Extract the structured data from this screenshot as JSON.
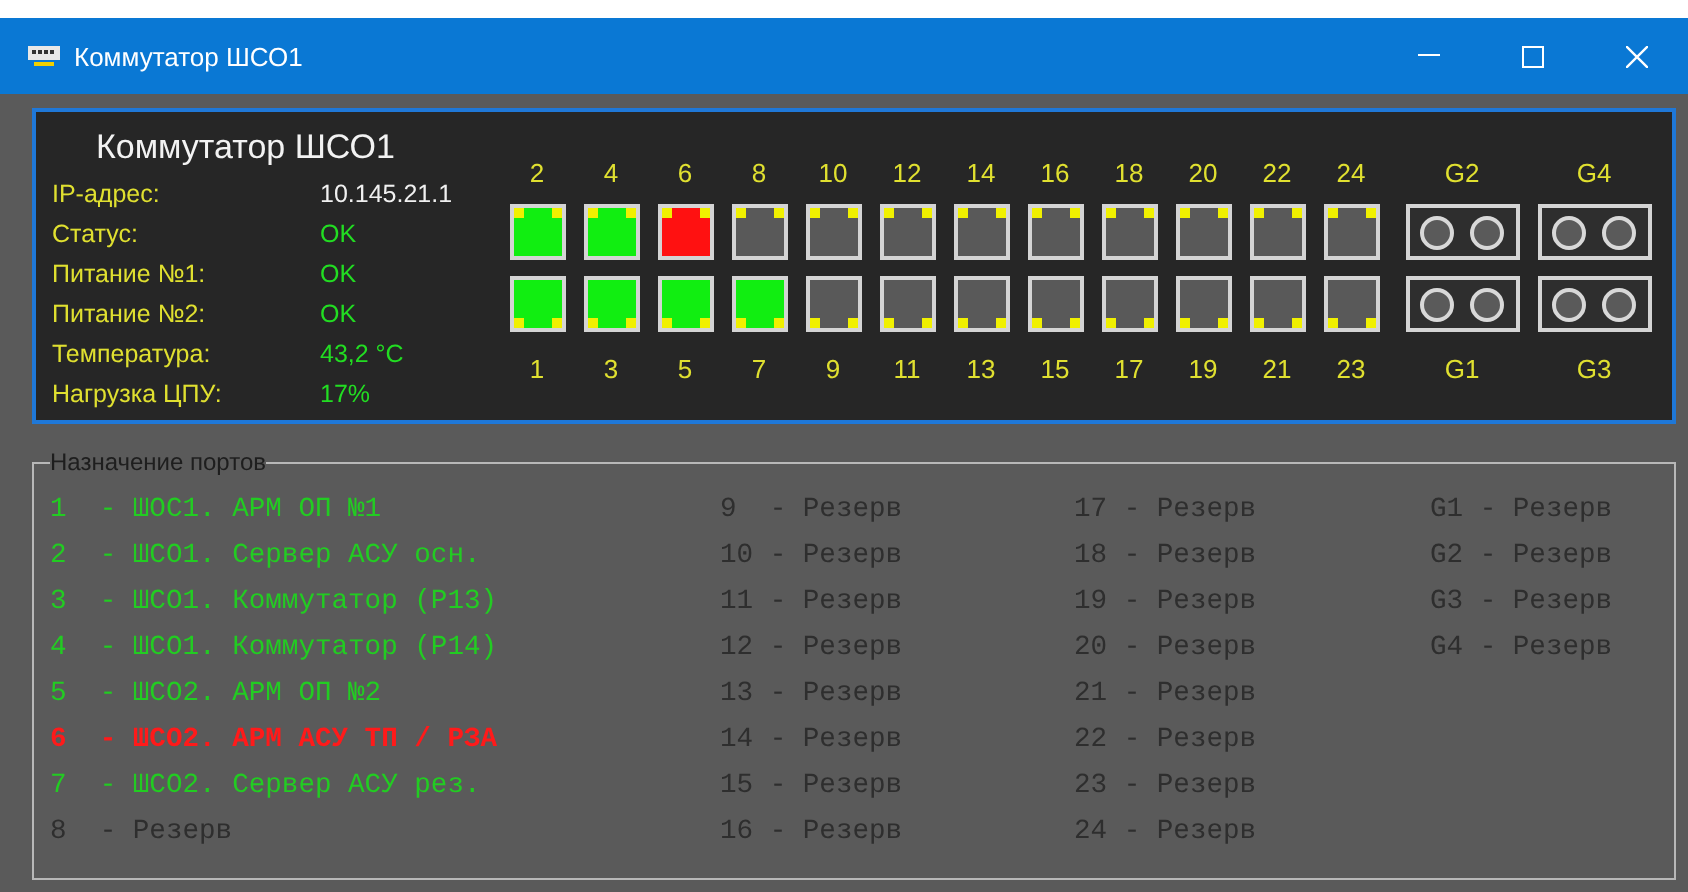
{
  "window": {
    "title": "Коммутатор ШСО1"
  },
  "device": {
    "title": "Коммутатор ШСО1",
    "info": [
      {
        "label": "IP-адрес:",
        "value": "10.145.21.1",
        "kind": "plain"
      },
      {
        "label": "Статус:",
        "value": "OK",
        "kind": "good"
      },
      {
        "label": "Питание №1:",
        "value": "OK",
        "kind": "good"
      },
      {
        "label": "Питание №2:",
        "value": "OK",
        "kind": "good"
      },
      {
        "label": "Температура:",
        "value": "43,2 °C",
        "kind": "good"
      },
      {
        "label": "Нагрузка ЦПУ:",
        "value": "17%",
        "kind": "good"
      }
    ]
  },
  "ports": [
    {
      "kind": "rj45",
      "top": {
        "label": "2",
        "link": true,
        "fault": false
      },
      "bottom": {
        "label": "1",
        "link": true,
        "fault": false
      }
    },
    {
      "kind": "rj45",
      "top": {
        "label": "4",
        "link": true,
        "fault": false
      },
      "bottom": {
        "label": "3",
        "link": true,
        "fault": false
      }
    },
    {
      "kind": "rj45",
      "top": {
        "label": "6",
        "link": true,
        "fault": true
      },
      "bottom": {
        "label": "5",
        "link": true,
        "fault": false
      }
    },
    {
      "kind": "rj45",
      "top": {
        "label": "8",
        "link": false,
        "fault": false
      },
      "bottom": {
        "label": "7",
        "link": true,
        "fault": false
      }
    },
    {
      "kind": "rj45",
      "top": {
        "label": "10",
        "link": false,
        "fault": false
      },
      "bottom": {
        "label": "9",
        "link": false,
        "fault": false
      }
    },
    {
      "kind": "rj45",
      "top": {
        "label": "12",
        "link": false,
        "fault": false
      },
      "bottom": {
        "label": "11",
        "link": false,
        "fault": false
      }
    },
    {
      "kind": "rj45",
      "top": {
        "label": "14",
        "link": false,
        "fault": false
      },
      "bottom": {
        "label": "13",
        "link": false,
        "fault": false
      }
    },
    {
      "kind": "rj45",
      "top": {
        "label": "16",
        "link": false,
        "fault": false
      },
      "bottom": {
        "label": "15",
        "link": false,
        "fault": false
      }
    },
    {
      "kind": "rj45",
      "top": {
        "label": "18",
        "link": false,
        "fault": false
      },
      "bottom": {
        "label": "17",
        "link": false,
        "fault": false
      }
    },
    {
      "kind": "rj45",
      "top": {
        "label": "20",
        "link": false,
        "fault": false
      },
      "bottom": {
        "label": "19",
        "link": false,
        "fault": false
      }
    },
    {
      "kind": "rj45",
      "top": {
        "label": "22",
        "link": false,
        "fault": false
      },
      "bottom": {
        "label": "21",
        "link": false,
        "fault": false
      }
    },
    {
      "kind": "rj45",
      "top": {
        "label": "24",
        "link": false,
        "fault": false
      },
      "bottom": {
        "label": "23",
        "link": false,
        "fault": false
      }
    },
    {
      "kind": "sfp",
      "top": {
        "label": "G2"
      },
      "bottom": {
        "label": "G1"
      }
    },
    {
      "kind": "sfp",
      "top": {
        "label": "G4"
      },
      "bottom": {
        "label": "G3"
      }
    }
  ],
  "assignment": {
    "title": "Назначение портов",
    "columns": [
      [
        {
          "text": "1  - ШОС1. АРМ ОП №1",
          "used": true,
          "fault": false
        },
        {
          "text": "2  - ШСО1. Сервер АСУ осн.",
          "used": true,
          "fault": false
        },
        {
          "text": "3  - ШСО1. Коммутатор (P13)",
          "used": true,
          "fault": false
        },
        {
          "text": "4  - ШСО1. Коммутатор (P14)",
          "used": true,
          "fault": false
        },
        {
          "text": "5  - ШСО2. АРМ ОП №2",
          "used": true,
          "fault": false
        },
        {
          "text": "6  - ШСО2. АРМ АСУ ТП / РЗА",
          "used": true,
          "fault": true
        },
        {
          "text": "7  - ШСО2. Сервер АСУ рез.",
          "used": true,
          "fault": false
        },
        {
          "text": "8  - Резерв",
          "used": false,
          "fault": false
        }
      ],
      [
        {
          "text": "9  - Резерв",
          "used": false,
          "fault": false
        },
        {
          "text": "10 - Резерв",
          "used": false,
          "fault": false
        },
        {
          "text": "11 - Резерв",
          "used": false,
          "fault": false
        },
        {
          "text": "12 - Резерв",
          "used": false,
          "fault": false
        },
        {
          "text": "13 - Резерв",
          "used": false,
          "fault": false
        },
        {
          "text": "14 - Резерв",
          "used": false,
          "fault": false
        },
        {
          "text": "15 - Резерв",
          "used": false,
          "fault": false
        },
        {
          "text": "16 - Резерв",
          "used": false,
          "fault": false
        }
      ],
      [
        {
          "text": "17 - Резерв",
          "used": false,
          "fault": false
        },
        {
          "text": "18 - Резерв",
          "used": false,
          "fault": false
        },
        {
          "text": "19 - Резерв",
          "used": false,
          "fault": false
        },
        {
          "text": "20 - Резерв",
          "used": false,
          "fault": false
        },
        {
          "text": "21 - Резерв",
          "used": false,
          "fault": false
        },
        {
          "text": "22 - Резерв",
          "used": false,
          "fault": false
        },
        {
          "text": "23 - Резерв",
          "used": false,
          "fault": false
        },
        {
          "text": "24 - Резерв",
          "used": false,
          "fault": false
        }
      ],
      [
        {
          "text": "G1 - Резерв",
          "used": false,
          "fault": false
        },
        {
          "text": "G2 - Резерв",
          "used": false,
          "fault": false
        },
        {
          "text": "G3 - Резерв",
          "used": false,
          "fault": false
        },
        {
          "text": "G4 - Резерв",
          "used": false,
          "fault": false
        }
      ]
    ]
  }
}
